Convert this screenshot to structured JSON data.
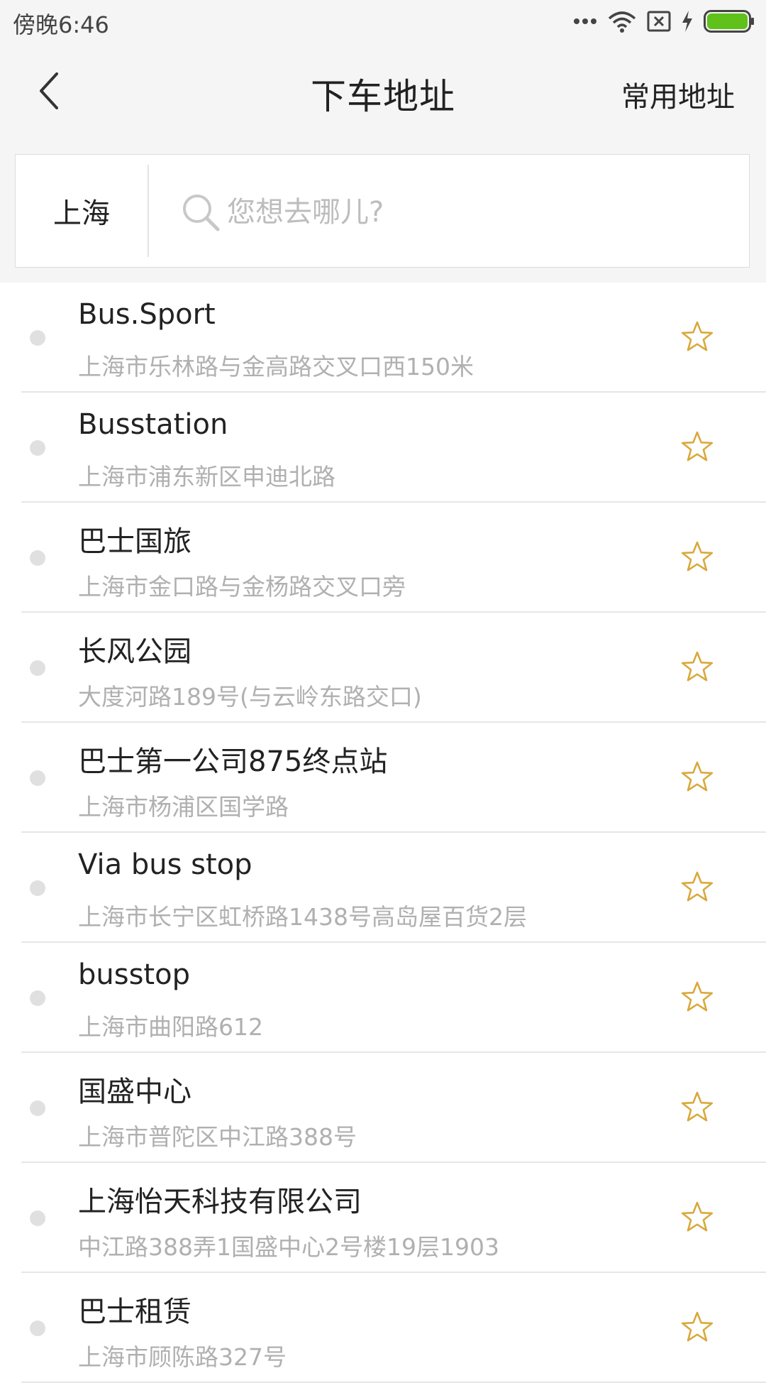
{
  "status_bar": {
    "time": "傍晚6:46",
    "icons": [
      "more-dots-icon",
      "wifi-icon",
      "sim-error-icon",
      "charging-icon",
      "battery-icon"
    ],
    "battery_color": "#5fc11a"
  },
  "nav": {
    "title": "下车地址",
    "right_label": "常用地址"
  },
  "search": {
    "city": "上海",
    "value": "",
    "placeholder": "您想去哪儿?"
  },
  "colors": {
    "star": "#d9a93c",
    "dot": "#e0e0e0",
    "secondary_text": "#b0b0b0"
  },
  "results": [
    {
      "name": "Bus.Sport",
      "address": "上海市乐林路与金高路交叉口西150米"
    },
    {
      "name": "Busstation",
      "address": "上海市浦东新区申迪北路"
    },
    {
      "name": "巴士国旅",
      "address": "上海市金口路与金杨路交叉口旁"
    },
    {
      "name": "长风公园",
      "address": "大度河路189号(与云岭东路交口)"
    },
    {
      "name": "巴士第一公司875终点站",
      "address": "上海市杨浦区国学路"
    },
    {
      "name": "Via bus stop",
      "address": "上海市长宁区虹桥路1438号高岛屋百货2层"
    },
    {
      "name": "busstop",
      "address": "上海市曲阳路612"
    },
    {
      "name": "国盛中心",
      "address": "上海市普陀区中江路388号"
    },
    {
      "name": "上海怡天科技有限公司",
      "address": "中江路388弄1国盛中心2号楼19层1903"
    },
    {
      "name": "巴士租赁",
      "address": "上海市顾陈路327号"
    }
  ]
}
